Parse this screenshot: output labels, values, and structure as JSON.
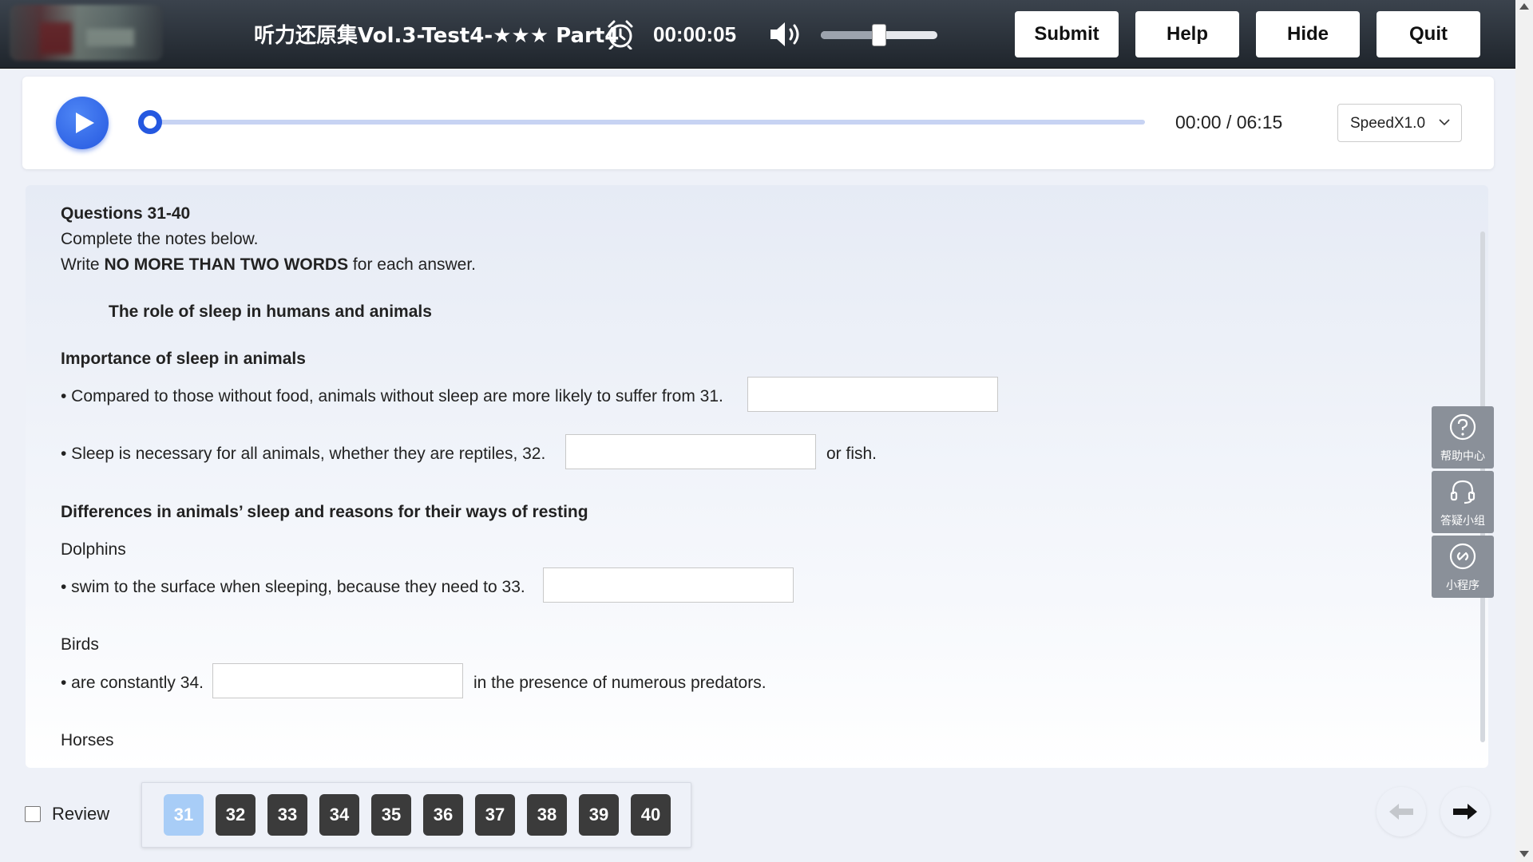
{
  "header": {
    "test_title": "听力还原集Vol.3-Test4-★★★ Part4",
    "timer": "00:00:05",
    "volume_level": 0.5,
    "buttons": {
      "submit": "Submit",
      "help": "Help",
      "hide": "Hide",
      "quit": "Quit"
    }
  },
  "player": {
    "time_readout": "00:00 / 06:15",
    "progress": 0,
    "speed": "SpeedX1.0"
  },
  "questions": {
    "range_title": "Questions 31-40",
    "instruction1": "Complete the notes below.",
    "instruction2_pre": "Write ",
    "instruction2_bold": "NO MORE THAN TWO WORDS",
    "instruction2_post": " for each answer.",
    "notes_title": "The role of sleep in humans and animals",
    "section1_heading": "Importance of sleep in animals",
    "q31_text": "• Compared to those without food, animals without sleep are more likely to suffer from 31.",
    "q32_text": "• Sleep is necessary for all animals, whether they are reptiles, 32.",
    "q32_after": "or fish.",
    "section2_heading": "Differences in animals’ sleep and reasons for their ways of resting",
    "dolphins": "Dolphins",
    "q33_text": "• swim to the surface when sleeping, because they need to 33.",
    "birds": "Birds",
    "q34_text": "• are constantly 34.",
    "q34_after": "in the presence of numerous predators.",
    "horses": "Horses",
    "answers": {
      "q31": "",
      "q32": "",
      "q33": "",
      "q34": ""
    }
  },
  "side_tools": [
    {
      "label": "帮助中心",
      "icon": "question-icon"
    },
    {
      "label": "答疑小组",
      "icon": "headset-icon"
    },
    {
      "label": "小程序",
      "icon": "link-icon"
    }
  ],
  "bottom": {
    "review_label": "Review",
    "review_checked": false,
    "question_numbers": [
      "31",
      "32",
      "33",
      "34",
      "35",
      "36",
      "37",
      "38",
      "39",
      "40"
    ],
    "active_question": "31"
  },
  "colors": {
    "accent": "#2558e0",
    "active_question": "#a8cdf7",
    "question_button": "#3b3b3b",
    "top_bar": "#2b323a"
  }
}
